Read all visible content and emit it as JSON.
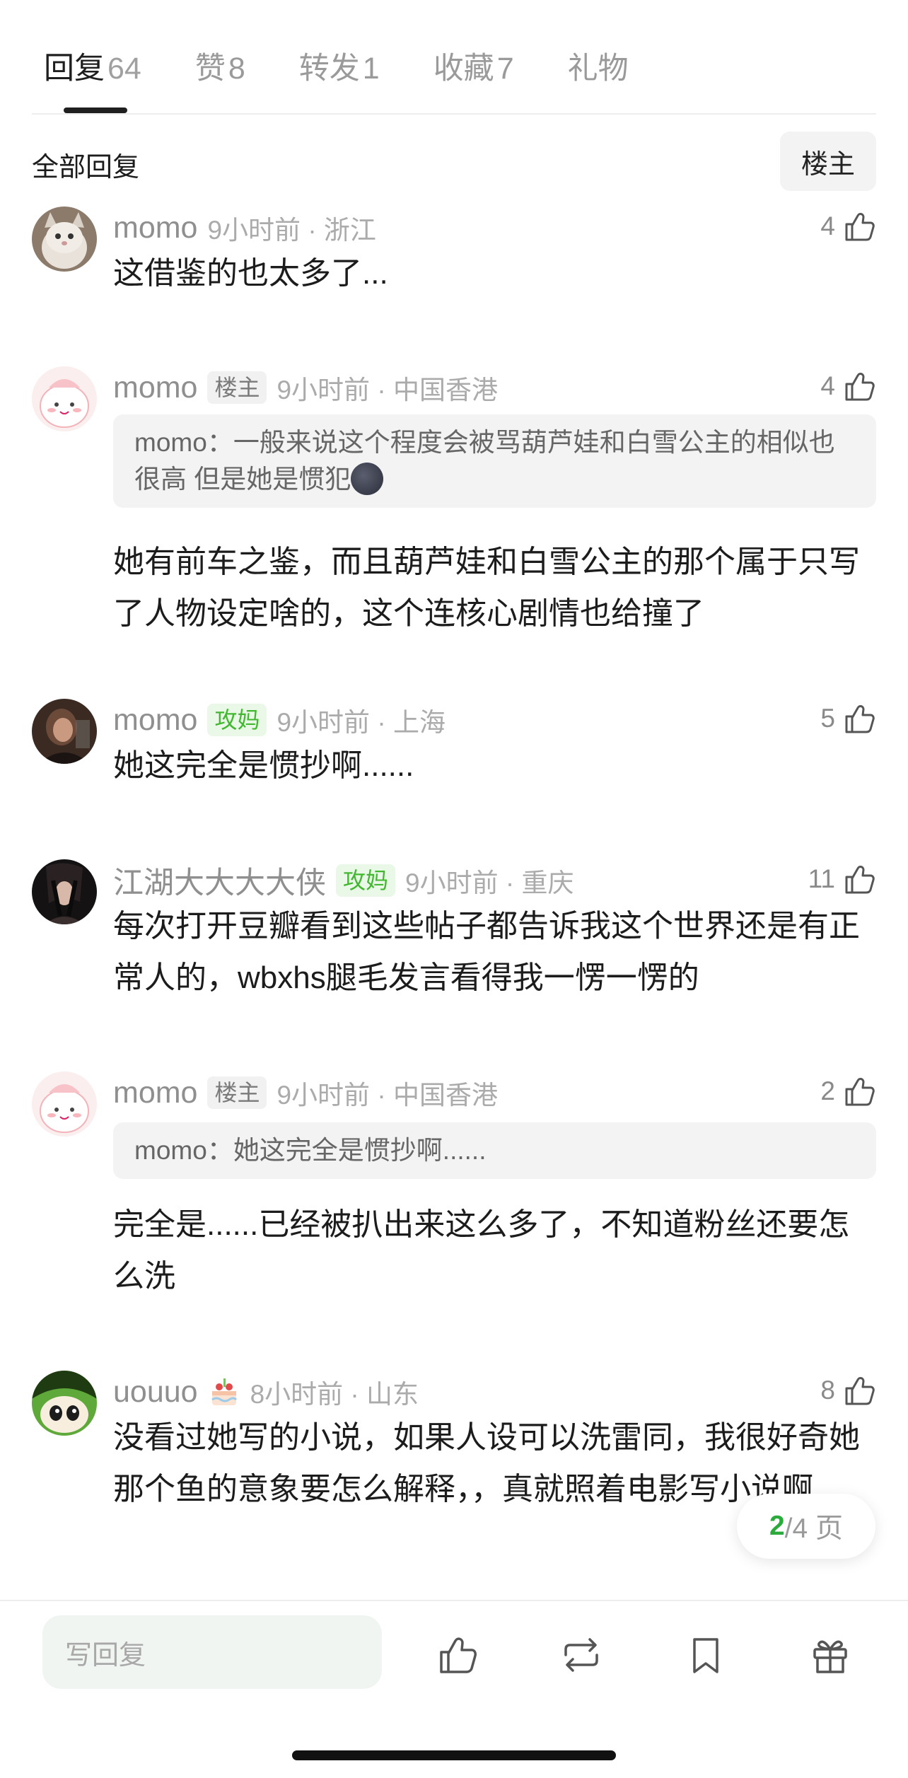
{
  "tabs": [
    {
      "label": "回复",
      "count": "64"
    },
    {
      "label": "赞",
      "count": "8"
    },
    {
      "label": "转发",
      "count": "1"
    },
    {
      "label": "收藏",
      "count": "7"
    },
    {
      "label": "礼物",
      "count": ""
    }
  ],
  "filter": {
    "all_replies": "全部回复",
    "op_only": "楼主"
  },
  "comments": [
    {
      "name": "momo",
      "tag": "",
      "time": "9小时前 · 浙江",
      "likes": "4",
      "text": "这借鉴的也太多了...",
      "quote": ""
    },
    {
      "name": "momo",
      "tag": "楼主",
      "time": "9小时前 · 中国香港",
      "likes": "4",
      "quote_user": "momo",
      "quote": "一般来说这个程度会被骂葫芦娃和白雪公主的相似也很高 但是她是惯犯",
      "text": "她有前车之鉴，而且葫芦娃和白雪公主的那个属于只写了人物设定啥的，这个连核心剧情也给撞了"
    },
    {
      "name": "momo",
      "tag": "攻妈",
      "time": "9小时前 · 上海",
      "likes": "5",
      "text": "她这完全是惯抄啊......",
      "quote": ""
    },
    {
      "name": "江湖大大大大侠",
      "tag": "攻妈",
      "time": "9小时前 · 重庆",
      "likes": "11",
      "text": "每次打开豆瓣看到这些帖子都告诉我这个世界还是有正常人的，wbxhs腿毛发言看得我一愣一愣的",
      "quote": ""
    },
    {
      "name": "momo",
      "tag": "楼主",
      "time": "9小时前 · 中国香港",
      "likes": "2",
      "quote_user": "momo",
      "quote": "她这完全是惯抄啊......",
      "text": "完全是......已经被扒出来这么多了，不知道粉丝还要怎么洗"
    },
    {
      "name": "uouuo",
      "tag": "",
      "time": "8小时前 · 山东",
      "likes": "8",
      "text": "没看过她写的小说，如果人设可以洗雷同，我很好奇她那个鱼的意象要怎么解释，，真就照着电影写小说啊",
      "quote": ""
    }
  ],
  "pager": {
    "current": "2",
    "total": "/4 页"
  },
  "bottom_bar": {
    "reply_placeholder": "写回复",
    "icons": [
      "like-icon",
      "repost-icon",
      "bookmark-icon",
      "gift-icon"
    ]
  },
  "colors": {
    "green": "#2cab3d",
    "tag_green": "#41b82f"
  }
}
